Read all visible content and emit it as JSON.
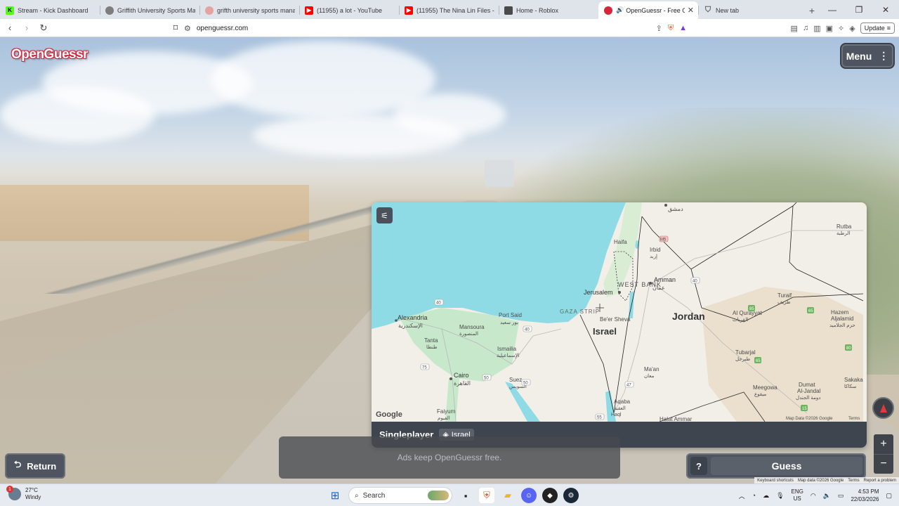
{
  "browser": {
    "tabs": [
      {
        "title": "Stream - Kick Dashboard",
        "fav_color": "#53fc18",
        "fav_text": "K"
      },
      {
        "title": "Griffith University Sports Mana",
        "fav_color": "#7d7d7d",
        "fav_text": ""
      },
      {
        "title": "grifth university sports manage",
        "fav_color": "#e6a1a1",
        "fav_text": ""
      },
      {
        "title": "(11955) a lot - YouTube",
        "fav_color": "#ff0000",
        "fav_text": "▶"
      },
      {
        "title": "(11955) The Nina Lin Files - Yo",
        "fav_color": "#ff0000",
        "fav_text": "▶"
      },
      {
        "title": "Home - Roblox",
        "fav_color": "#4a4a4a",
        "fav_text": ""
      },
      {
        "title": "OpenGuessr - Free Geo",
        "fav_color": "#d6263e",
        "fav_text": ""
      },
      {
        "title": "New tab",
        "fav_color": "#5f6368",
        "fav_text": ""
      }
    ],
    "url": "openguessr.com",
    "update_label": "Update"
  },
  "game": {
    "logo": "OpenGuessr",
    "menu_label": "Menu",
    "mode": "Singleplayer",
    "region": "Israel",
    "ad_text": "Ads keep OpenGuessr free.",
    "return_label": "Return",
    "help_label": "?",
    "guess_label": "Guess",
    "footer": [
      "Keyboard shortcuts",
      "Map data ©2026 Google",
      "Terms",
      "Report a problem"
    ]
  },
  "map": {
    "attribution": "Map Data ©2026 Google",
    "terms": "Terms",
    "google": "Google",
    "labels": {
      "alexandria": "Alexandria",
      "alexandria_ar": "الإسكندرية",
      "port_said": "Port Said",
      "port_said_ar": "بور سعيد",
      "mansoura": "Mansoura",
      "mansoura_ar": "المنصورة",
      "tanta": "Tanta",
      "tanta_ar": "طنطا",
      "ismailia": "Ismailia",
      "ismailia_ar": "الإسماعيلية",
      "cairo": "Cairo",
      "cairo_ar": "القاهرة",
      "suez": "Suez",
      "suez_ar": "السويس",
      "faiyum": "Faiyum",
      "faiyum_ar": "الفيوم",
      "haifa": "Haifa",
      "irbid": "Irbid",
      "irbid_ar": "إربد",
      "west_bank": "WEST BANK",
      "amman": "Amman",
      "amman_ar": "عمان",
      "jerusalem": "Jerusalem",
      "gaza": "GAZA STRIP",
      "beer_sheva": "Be'er Sheva",
      "israel": "Israel",
      "jordan": "Jordan",
      "damascus_ar": "دمشق",
      "rutba": "Rutba",
      "rutba_ar": "الرطبة",
      "turaif": "Turaif",
      "turaif_ar": "طريف",
      "al_qurayyat": "Al Qurayyat",
      "al_qurayyat_ar": "القريات",
      "hazem": "Hazem",
      "hazem2": "Aljalamid",
      "hazem_ar": "حزم الجلاميد",
      "tubarjal": "Tubarjal",
      "tubarjal_ar": "طبرجل",
      "maan": "Ma'an",
      "maan_ar": "معان",
      "aqaba": "Aqaba",
      "aqaba_ar": "العقبة",
      "meegowa": "Meegowa",
      "meegowa_ar": "ميقوع",
      "dumat": "Dumat",
      "dumat2": "Al-Jandal",
      "dumat_ar": "دومة الجندل",
      "sakaka": "Sakaka",
      "sakaka_ar": "سكاكا",
      "halat": "Halat Ammar",
      "haql": "Haql",
      "r40": "40",
      "r75": "75",
      "r50": "50",
      "r55": "55",
      "r47": "47",
      "r65": "65",
      "r85": "85",
      "r80": "80",
      "r15": "15",
      "m45": "M5"
    }
  },
  "taskbar": {
    "temp": "27°C",
    "condition": "Windy",
    "weather_badge": "1",
    "search_label": "Search",
    "lang": "ENG",
    "region": "US",
    "time": "4:53 PM",
    "date": "22/03/2026"
  }
}
